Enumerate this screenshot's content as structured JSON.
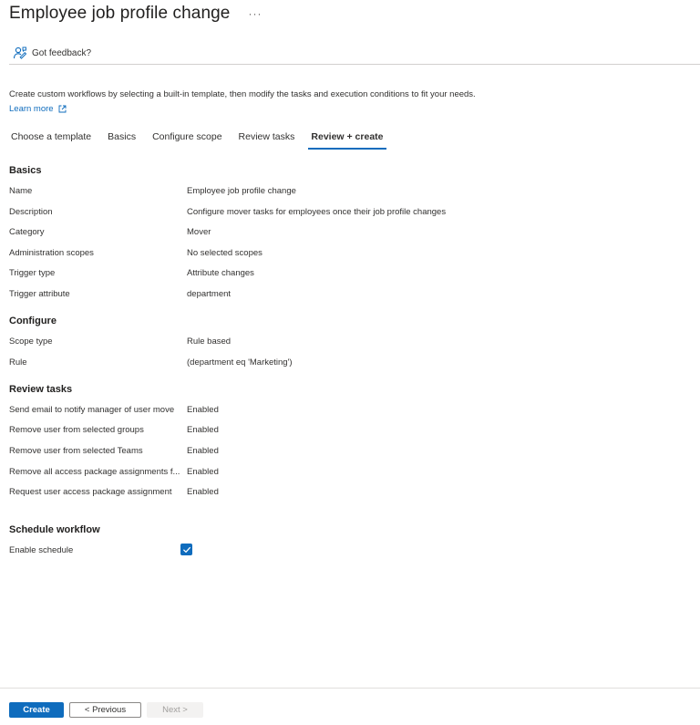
{
  "header": {
    "title": "Employee job profile change",
    "more_glyph": "···",
    "feedback_label": "Got feedback?"
  },
  "intro": {
    "text": "Create custom workflows by selecting a built-in template, then modify the tasks and execution conditions to fit your needs.",
    "learn_more": "Learn more"
  },
  "tabs": [
    {
      "label": "Choose a template",
      "active": false
    },
    {
      "label": "Basics",
      "active": false
    },
    {
      "label": "Configure scope",
      "active": false
    },
    {
      "label": "Review tasks",
      "active": false
    },
    {
      "label": "Review + create",
      "active": true
    }
  ],
  "basics": {
    "heading": "Basics",
    "rows": [
      {
        "label": "Name",
        "value": "Employee job profile change"
      },
      {
        "label": "Description",
        "value": "Configure mover tasks for employees once their job profile changes"
      },
      {
        "label": "Category",
        "value": "Mover"
      },
      {
        "label": "Administration scopes",
        "value": "No selected scopes"
      },
      {
        "label": "Trigger type",
        "value": "Attribute changes"
      },
      {
        "label": "Trigger attribute",
        "value": "department"
      }
    ]
  },
  "configure": {
    "heading": "Configure",
    "rows": [
      {
        "label": "Scope type",
        "value": "Rule based"
      },
      {
        "label": "Rule",
        "value": "(department eq 'Marketing')"
      }
    ]
  },
  "review_tasks": {
    "heading": "Review tasks",
    "rows": [
      {
        "label": "Send email to notify manager of user move",
        "value": "Enabled"
      },
      {
        "label": "Remove user from selected groups",
        "value": "Enabled"
      },
      {
        "label": "Remove user from selected Teams",
        "value": "Enabled"
      },
      {
        "label": "Remove all access package assignments f...",
        "value": "Enabled"
      },
      {
        "label": "Request user access package assignment",
        "value": "Enabled"
      }
    ]
  },
  "schedule": {
    "heading": "Schedule workflow",
    "enable_label": "Enable schedule",
    "enabled": true
  },
  "footer": {
    "create_label": "Create",
    "previous_label": "< Previous",
    "next_label": "Next >"
  },
  "colors": {
    "accent": "#0f6cbd",
    "text": "#323130",
    "disabled_text": "#a19f9d"
  },
  "icons": {
    "feedback": "feedback-person-icon",
    "external": "open-external-icon",
    "checkmark": "checkmark-icon"
  }
}
